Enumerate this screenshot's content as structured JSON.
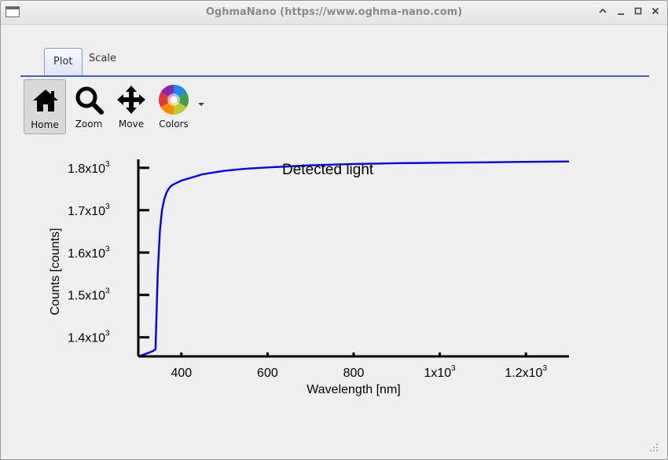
{
  "window": {
    "title": "OghmaNano (https://www.oghma-nano.com)",
    "controls": [
      "chevron-up",
      "minimize",
      "maximize",
      "close"
    ]
  },
  "tabs": [
    {
      "label": "Plot",
      "active": true
    },
    {
      "label": "Scale",
      "active": false
    }
  ],
  "toolbar": {
    "items": [
      {
        "label": "Home",
        "icon": "home-icon",
        "active": true
      },
      {
        "label": "Zoom",
        "icon": "magnifier-icon",
        "active": false
      },
      {
        "label": "Move",
        "icon": "move-arrows-icon",
        "active": false
      },
      {
        "label": "Colors",
        "icon": "color-wheel-icon",
        "active": false
      }
    ]
  },
  "chart_data": {
    "type": "line",
    "title": "Detected light",
    "xlabel": "Wavelength [nm]",
    "ylabel": "Counts [counts]",
    "xlim": [
      300,
      1300
    ],
    "ylim": [
      1355,
      1820
    ],
    "x_ticks": [
      {
        "value": 400,
        "label": "400"
      },
      {
        "value": 600,
        "label": "600"
      },
      {
        "value": 800,
        "label": "800"
      },
      {
        "value": 1000,
        "label": "1x10",
        "sup": "3"
      },
      {
        "value": 1200,
        "label": "1.2x10",
        "sup": "3"
      }
    ],
    "y_ticks": [
      {
        "value": 1400,
        "label": "1.4x10",
        "sup": "3"
      },
      {
        "value": 1500,
        "label": "1.5x10",
        "sup": "3"
      },
      {
        "value": 1600,
        "label": "1.6x10",
        "sup": "3"
      },
      {
        "value": 1700,
        "label": "1.7x10",
        "sup": "3"
      },
      {
        "value": 1800,
        "label": "1.8x10",
        "sup": "3"
      }
    ],
    "series": [
      {
        "color": "#0000ee",
        "x": [
          300,
          320,
          335,
          340,
          345,
          350,
          355,
          360,
          365,
          370,
          375,
          380,
          390,
          400,
          420,
          450,
          500,
          550,
          600,
          700,
          800,
          900,
          1000,
          1100,
          1200,
          1300
        ],
        "y": [
          1355,
          1362,
          1368,
          1372,
          1550,
          1650,
          1700,
          1725,
          1740,
          1750,
          1756,
          1760,
          1765,
          1770,
          1776,
          1785,
          1793,
          1798,
          1801,
          1806,
          1809,
          1811,
          1812,
          1813,
          1814,
          1815
        ]
      }
    ]
  }
}
